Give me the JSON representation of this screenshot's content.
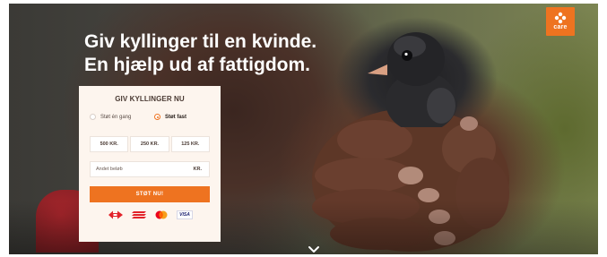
{
  "hero": {
    "headline_line1": "Giv kyllinger til en kvinde.",
    "headline_line2": "En hjælp ud af fattigdom."
  },
  "logo": {
    "wordmark": "care",
    "icon": "care-logo-icon",
    "color": "#ee7320"
  },
  "form": {
    "title": "GIV KYLLINGER NU",
    "frequency": {
      "options": [
        {
          "label": "Støt én gang",
          "selected": false
        },
        {
          "label": "Støt fast",
          "selected": true
        }
      ]
    },
    "amounts": [
      "500 KR.",
      "250 KR.",
      "125 KR."
    ],
    "other_amount": {
      "placeholder": "Andet beløb",
      "unit": "KR."
    },
    "submit_label": "STØT NU!",
    "payment_methods": [
      "dankort-icon",
      "mobilepay-icon",
      "mastercard-icon",
      "visa-icon"
    ],
    "visa_text": "VISA"
  },
  "colors": {
    "accent": "#ee7320",
    "card_background": "#fdf5ee",
    "text_dark": "#4a3a33"
  },
  "scroll_icon": "chevron-down-icon"
}
